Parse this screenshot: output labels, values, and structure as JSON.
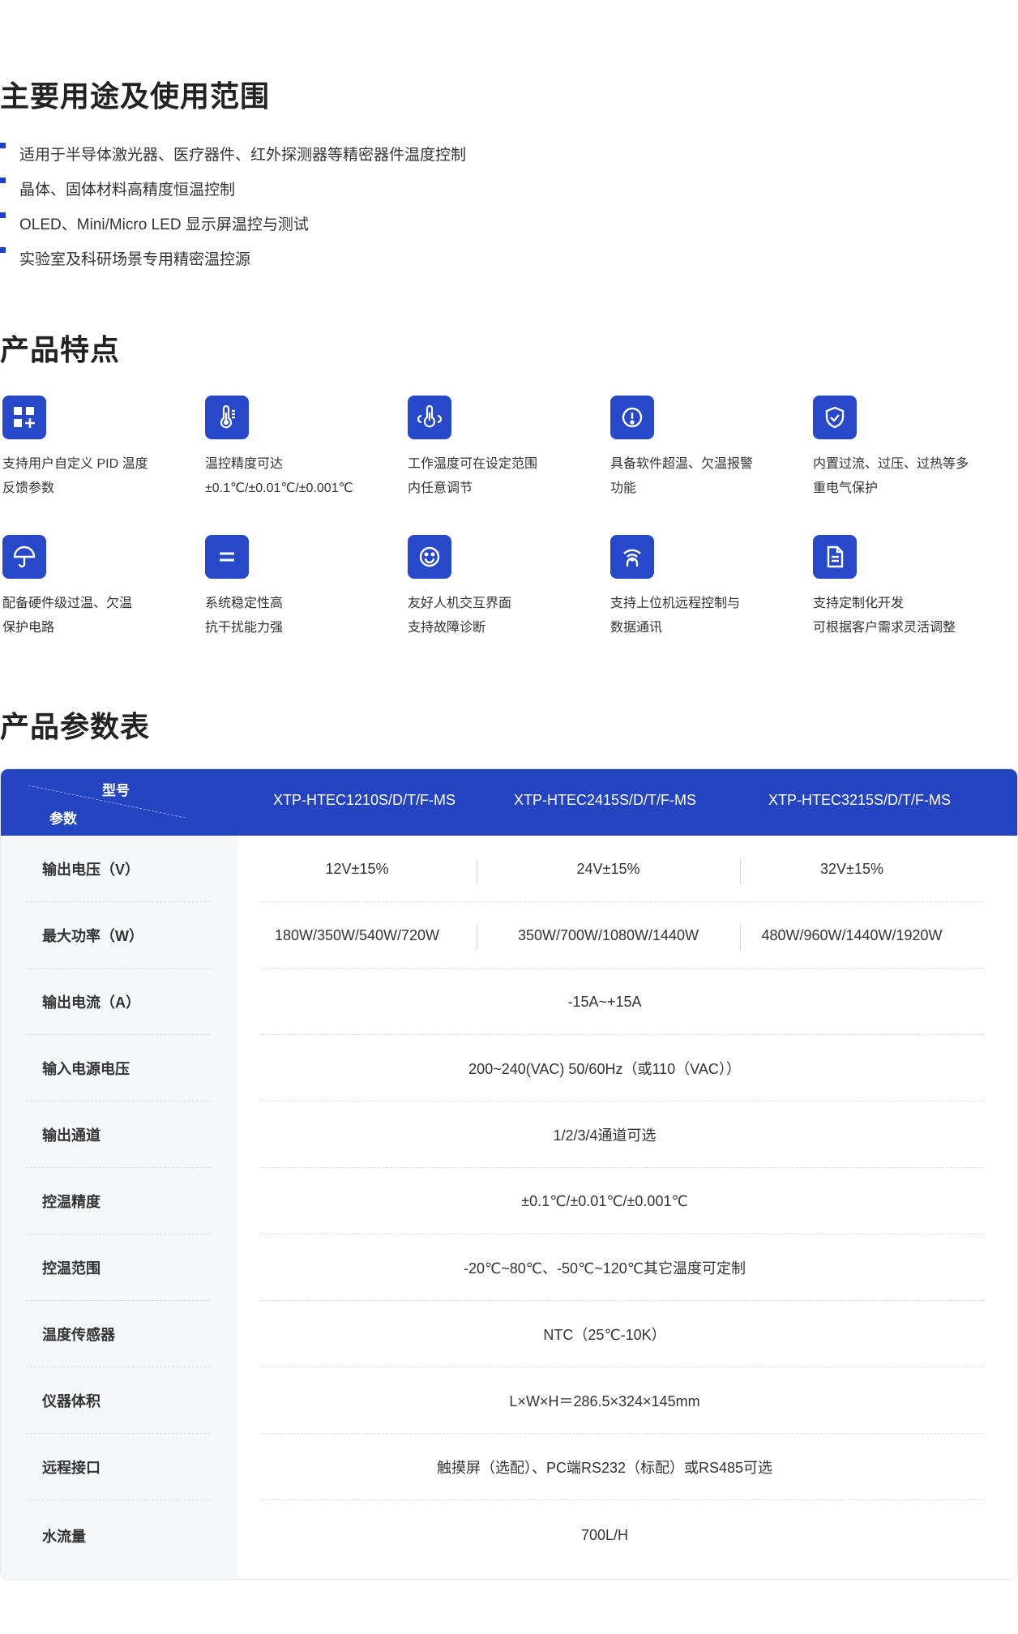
{
  "usage": {
    "title": "主要用途及使用范围",
    "items": [
      "适用于半导体激光器、医疗器件、红外探测器等精密器件温度控制",
      "晶体、固体材料高精度恒温控制",
      "OLED、Mini/Micro LED 显示屏温控与测试",
      "实验室及科研场景专用精密温控源"
    ]
  },
  "features": {
    "title": "产品特点",
    "items": [
      {
        "icon": "apps-grid-icon",
        "line1": "支持用户自定义 PID 温度",
        "line2": "反馈参数"
      },
      {
        "icon": "thermometer-icon",
        "line1": "温控精度可达",
        "line2": "±0.1℃/±0.01℃/±0.001℃"
      },
      {
        "icon": "temperature-range-icon",
        "line1": "工作温度可在设定范围",
        "line2": "内任意调节"
      },
      {
        "icon": "alert-circle-icon",
        "line1": "具备软件超温、欠温报警",
        "line2": "功能"
      },
      {
        "icon": "shield-check-icon",
        "line1": "内置过流、过压、过热等多",
        "line2": "重电气保护"
      },
      {
        "icon": "umbrella-icon",
        "line1": "配备硬件级过温、欠温",
        "line2": "保护电路"
      },
      {
        "icon": "equals-icon",
        "line1": "系统稳定性高",
        "line2": "抗干扰能力强"
      },
      {
        "icon": "smile-face-icon",
        "line1": "友好人机交互界面",
        "line2": "支持故障诊断"
      },
      {
        "icon": "wireless-signal-icon",
        "line1": "支持上位机远程控制与",
        "line2": "数据通讯"
      },
      {
        "icon": "document-icon",
        "line1": "支持定制化开发",
        "line2": "可根据客户需求灵活调整"
      }
    ]
  },
  "params": {
    "title": "产品参数表",
    "header": {
      "model_label": "型号",
      "param_label": "参数",
      "columns": [
        "XTP-HTEC1210S/D/T/F-MS",
        "XTP-HTEC2415S/D/T/F-MS",
        "XTP-HTEC3215S/D/T/F-MS"
      ]
    },
    "rows": [
      {
        "label": "输出电压（V）",
        "values": [
          "12V±15%",
          "24V±15%",
          "32V±15%"
        ]
      },
      {
        "label": "最大功率（W）",
        "values": [
          "180W/350W/540W/720W",
          "350W/700W/1080W/1440W",
          "480W/960W/1440W/1920W"
        ]
      },
      {
        "label": "输出电流（A）",
        "values": [
          "-15A~+15A"
        ]
      },
      {
        "label": "输入电源电压",
        "values": [
          "200~240(VAC) 50/60Hz（或110（VAC））"
        ]
      },
      {
        "label": "输出通道",
        "values": [
          "1/2/3/4通道可选"
        ]
      },
      {
        "label": "控温精度",
        "values": [
          "±0.1℃/±0.01℃/±0.001℃"
        ]
      },
      {
        "label": "控温范围",
        "values": [
          "-20℃~80℃、-50℃~120℃其它温度可定制"
        ]
      },
      {
        "label": "温度传感器",
        "values": [
          "NTC（25℃-10K）"
        ]
      },
      {
        "label": "仪器体积",
        "values": [
          "L×W×H＝286.5×324×145mm"
        ]
      },
      {
        "label": "远程接口",
        "values": [
          "触摸屏（选配）、PC端RS232（标配）或RS485可选"
        ]
      },
      {
        "label": "水流量",
        "values": [
          "700L/H"
        ]
      }
    ]
  }
}
